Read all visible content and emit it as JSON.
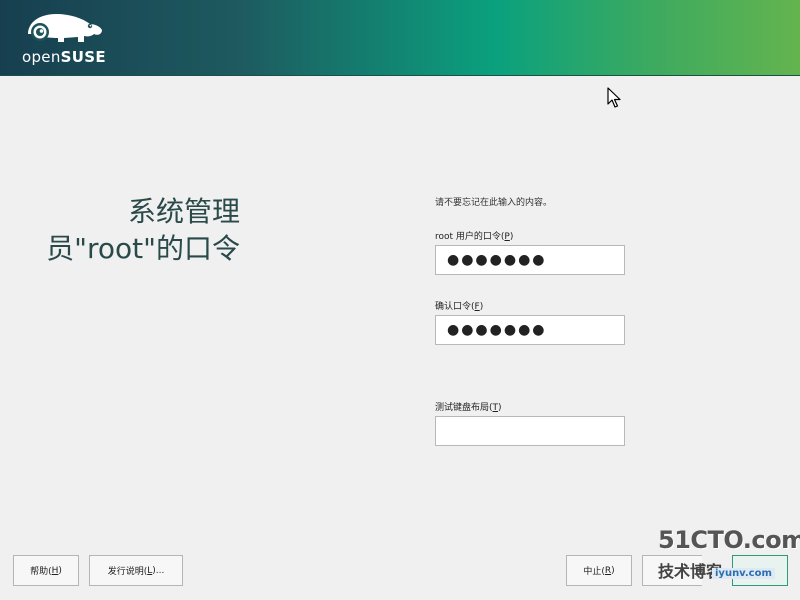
{
  "header": {
    "logo_text_light": "open",
    "logo_text_bold": "SUSE"
  },
  "page": {
    "title_line1": "系统管理",
    "title_line2": "员\"root\"的口令",
    "hint": "请不要忘记在此输入的内容。"
  },
  "fields": {
    "password": {
      "label_prefix": "root 用户的口令(",
      "label_key": "P",
      "label_suffix": ")",
      "value": "●●●●●●●"
    },
    "confirm": {
      "label_prefix": "确认口令(",
      "label_key": "F",
      "label_suffix": ")",
      "value": "●●●●●●●"
    },
    "keyboard_test": {
      "label_prefix": "测试键盘布局(",
      "label_key": "T",
      "label_suffix": ")",
      "value": ""
    }
  },
  "buttons": {
    "help": {
      "prefix": "帮助(",
      "key": "H",
      "suffix": ")"
    },
    "release_notes": {
      "prefix": "发行说明(",
      "key": "L",
      "suffix": ")..."
    },
    "abort": {
      "prefix": "中止(",
      "key": "R",
      "suffix": ")"
    }
  },
  "watermark": {
    "top": "51CTO.com",
    "bottom": "技术博客",
    "url": "iyunv.com"
  },
  "colors": {
    "header_dark": "#173f4f",
    "header_mid": "#0aa17e",
    "header_light": "#64b44e",
    "background": "#f0f0f0",
    "title_text": "#2a4a4a"
  }
}
